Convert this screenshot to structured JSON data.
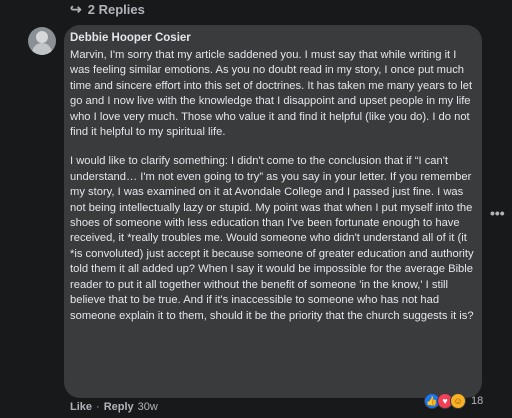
{
  "thread": {
    "replies_label": "2 Replies",
    "replies_arrow": "↪"
  },
  "comment": {
    "author": "Debbie Hooper Cosier",
    "paragraphs": [
      "Marvin, I'm sorry that my article saddened you. I must say that while writing it I was feeling similar emotions. As you no doubt read in my story, I once put much time and sincere effort into this set of doctrines. It has taken me many years to let go and I now live with the knowledge that I disappoint and upset people in my life who I love very much. Those who value it and find it helpful (like you do). I do not find it helpful to my spiritual life.",
      "I would like to clarify something: I didn't come to the conclusion that if “I can't understand… I'm not even going to try” as you say in your letter. If you remember my story, I was examined on it at Avondale College and I passed just fine. I was not being intellectually lazy or stupid. My point was that when I put myself into the shoes of someone with less education than I've been fortunate enough to have received, it *really troubles me. Would someone who didn't understand all of it (it *is convoluted) just accept it because someone of greater education and authority told them it all added up? When I say it would be impossible for the average Bible reader to put it all together without the benefit of someone 'in the know,' I still believe that to be true. And if it's inaccessible to someone who has not had someone explain it to them, should it be the priority that the church suggests it is?"
    ],
    "more_options": "•••",
    "actions": {
      "like": "Like",
      "reply": "Reply",
      "sep": "·",
      "time": "30w"
    },
    "reactions": {
      "icons": [
        "like-reaction",
        "love-reaction",
        "care-reaction"
      ],
      "count": "18"
    }
  },
  "colors": {
    "background": "#18191a",
    "bubble": "#3a3b3c",
    "text": "#e4e6eb",
    "secondary_text": "#b0b3b8",
    "like_blue": "#1877f2",
    "love_red": "#f33e58",
    "care_yellow": "#f7b125"
  }
}
